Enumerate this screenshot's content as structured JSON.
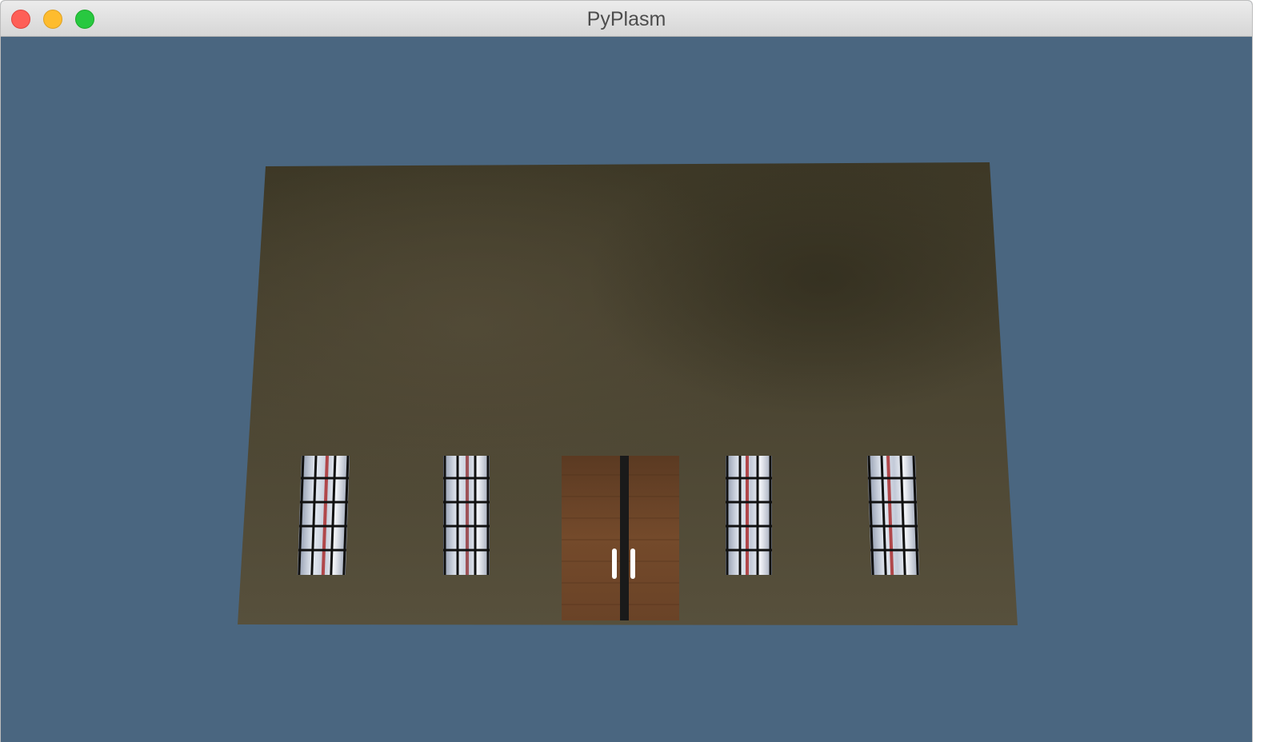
{
  "window": {
    "title": "PyPlasm"
  },
  "controls": {
    "close": "close-icon",
    "minimize": "minimize-icon",
    "zoom": "zoom-icon"
  },
  "scene": {
    "background_color": "#4a6680",
    "facade_color": "#4f4634",
    "door_color": "#6e4628",
    "window_glass_color": "#d3d9e6",
    "window_count": 4,
    "door_count": 1
  }
}
